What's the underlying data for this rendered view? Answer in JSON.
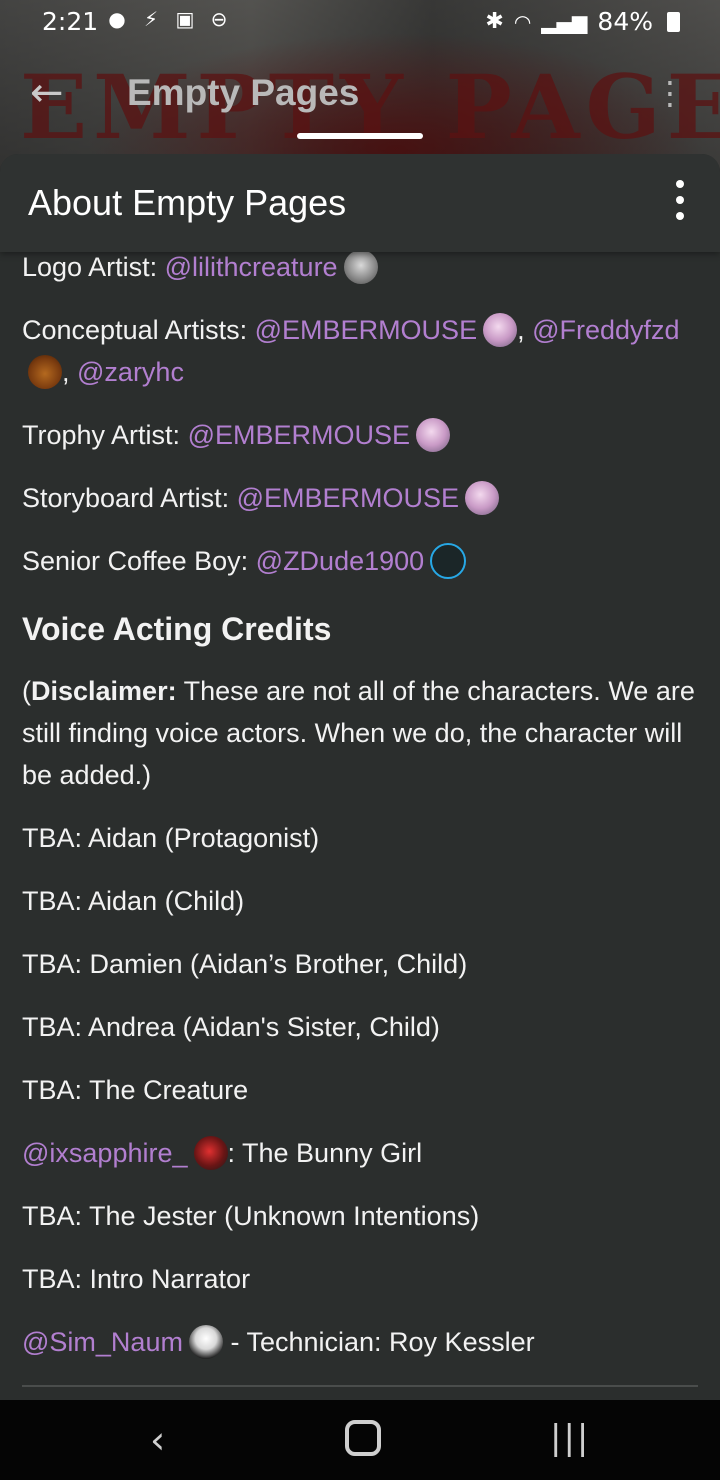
{
  "status_bar": {
    "time": "2:21",
    "battery": "84%"
  },
  "nav": {
    "title": "Empty Pages"
  },
  "sheet": {
    "title": "About Empty Pages"
  },
  "credits": {
    "logo_label": "Logo Artist:",
    "logo_mention": "@lilithcreature",
    "concept_label": "Conceptual Artists:",
    "concept_mention_1": "@EMBERMOUSE",
    "concept_mention_2": "@Freddyfzd",
    "concept_mention_3": "@zaryhc",
    "trophy_label": "Trophy Artist:",
    "trophy_mention": "@EMBERMOUSE",
    "storyboard_label": "Storyboard Artist:",
    "storyboard_mention": "@EMBERMOUSE",
    "coffee_label": "Senior Coffee Boy:",
    "coffee_mention": "@ZDude1900"
  },
  "voice": {
    "heading": "Voice Acting Credits",
    "disclaimer_bold": "Disclaimer:",
    "disclaimer_text": " These are not all of the characters. We are still finding voice actors. When we do, the character will be added.)",
    "lines": [
      "TBA: Aidan (Protagonist)",
      "TBA: Aidan (Child)",
      "TBA: Damien (Aidan’s Brother, Child)",
      "TBA: Andrea (Aidan's Sister, Child)",
      "TBA: The Creature"
    ],
    "bunny_mention": "@ixsapphire_",
    "bunny_role": ": The Bunny Girl",
    "lines2": [
      "TBA: The Jester (Unknown Intentions)",
      "TBA: Intro Narrator"
    ],
    "roy_mention": "@Sim_Naum",
    "roy_role": " - Technician: Roy Kessler"
  }
}
